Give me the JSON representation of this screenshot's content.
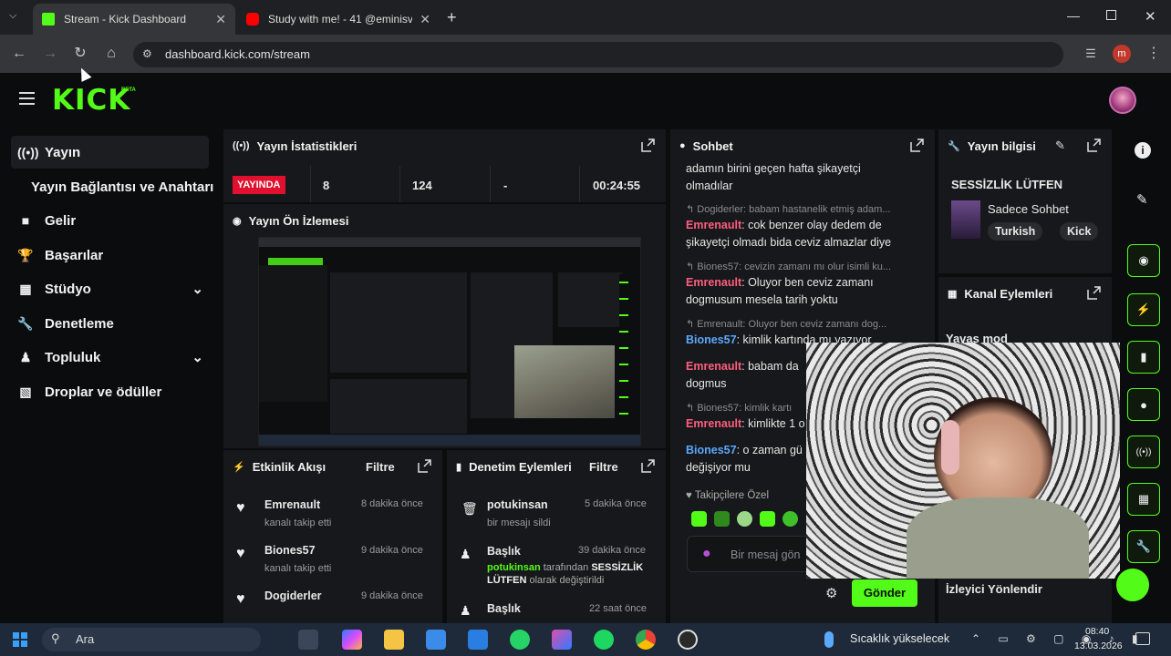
{
  "browser": {
    "tabs": [
      {
        "title": "Stream - Kick Dashboard",
        "active": true
      },
      {
        "title": "Study with me! - 41 @eminisvlo",
        "active": false
      }
    ],
    "url": "dashboard.kick.com/stream",
    "profile_initial": "m"
  },
  "app": {
    "logo": "KICK",
    "logo_badge": "BETA",
    "sidebar": [
      {
        "label": "Yayın",
        "icon": "broadcast-icon",
        "active": true
      },
      {
        "label": "Yayın Bağlantısı ve Anahtarı",
        "icon": "",
        "sub": true
      },
      {
        "label": "Gelir",
        "icon": "revenue-icon"
      },
      {
        "label": "Başarılar",
        "icon": "trophy-icon"
      },
      {
        "label": "Stüdyo",
        "icon": "studio-icon",
        "expandable": true
      },
      {
        "label": "Denetleme",
        "icon": "wrench-icon"
      },
      {
        "label": "Topluluk",
        "icon": "community-icon",
        "expandable": true
      },
      {
        "label": "Droplar ve ödüller",
        "icon": "drops-icon"
      }
    ],
    "stats": {
      "title": "Yayın İstatistikleri",
      "live_label": "YAYINDA",
      "values": [
        "8",
        "124",
        "-",
        "00:24:55"
      ]
    },
    "preview": {
      "title": "Yayın Ön İzlemesi"
    },
    "activity": {
      "title": "Etkinlik Akışı",
      "filter": "Filtre",
      "items": [
        {
          "user": "Emrenault",
          "text": "kanalı takip etti",
          "time": "8 dakika önce"
        },
        {
          "user": "Biones57",
          "text": "kanalı takip etti",
          "time": "9 dakika önce"
        },
        {
          "user": "Dogiderler",
          "text": "",
          "time": "9 dakika önce"
        }
      ]
    },
    "modlog": {
      "title": "Denetim Eylemleri",
      "filter": "Filtre",
      "items": [
        {
          "user": "potukinsan",
          "text": "bir mesajı sildi",
          "time": "5 dakika önce"
        },
        {
          "user": "Başlık",
          "actor": "potukinsan",
          "text_mid": " tarafından ",
          "highlight": "SESSİZLİK LÜTFEN",
          "text_end": " olarak değiştirildi",
          "time": "39 dakika önce"
        },
        {
          "user": "Başlık",
          "text": "",
          "time": "22 saat önce"
        }
      ]
    },
    "chat": {
      "title": "Sohbet",
      "messages": [
        {
          "text": "adamın birini geçen hafta şikayetçi olmadılar"
        },
        {
          "reply": "Dogiderler: babam hastanelik etmiş adam..."
        },
        {
          "user": "Emrenault",
          "color": "pink",
          "text": ": cok benzer olay dedem de şikayetçi olmadı bida ceviz almazlar diye"
        },
        {
          "reply": "Biones57: cevizin zamanı mı olur isimli ku..."
        },
        {
          "user": "Emrenault",
          "color": "pink",
          "text": ": Oluyor ben ceviz zamanı dogmusum mesela tarih yoktu"
        },
        {
          "reply": "Emrenault: Oluyor ben ceviz zamanı dog..."
        },
        {
          "user": "Biones57",
          "color": "blue",
          "text": ": kimlik kartında mı yazıyor"
        },
        {
          "user": "Emrenault",
          "color": "pink",
          "text": ": babam da"
        },
        {
          "text": "dogmus"
        },
        {
          "reply": "Biones57: kimlik kartı"
        },
        {
          "user": "Emrenault",
          "color": "pink",
          "text": ": kimlikte 1 o"
        },
        {
          "user": "Biones57",
          "color": "blue",
          "text": ": o zaman gü değişiyor mu"
        }
      ],
      "followers_label": "Takipçilere Özel",
      "input_placeholder": "Bir mesaj gön",
      "send_label": "Gönder"
    },
    "stream_info": {
      "title": "Yayın bilgisi",
      "stream_title": "SESSİZLİK LÜTFEN",
      "category": "Sadece Sohbet",
      "tags": [
        "Turkish",
        "Kick"
      ]
    },
    "channel_actions": {
      "title": "Kanal Eylemleri",
      "items": [
        "Yavaş mod",
        "İzleyici Yönlendir"
      ]
    }
  },
  "taskbar": {
    "search": "Ara",
    "weather": "Sıcaklık yükselecek",
    "time": "08:40",
    "date": "13.03.2026"
  },
  "colors": {
    "accent": "#53fc18",
    "live": "#e0102e",
    "pink_user": "#ff5e7e",
    "blue_user": "#5aa9ff"
  }
}
